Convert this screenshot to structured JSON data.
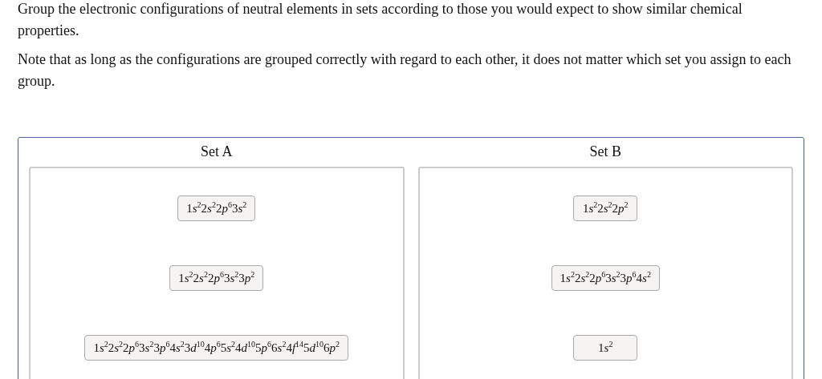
{
  "instructions": [
    "Group the electronic configurations of neutral elements in sets according to those you would expect to show similar chemical properties.",
    "Note that as long as the configurations are grouped correctly with regard to each other, it does not matter which set you assign to each group."
  ],
  "sets": [
    {
      "title": "Set A",
      "items": [
        [
          [
            "1",
            "s",
            "2"
          ],
          [
            "2",
            "s",
            "2"
          ],
          [
            "2",
            "p",
            "6"
          ],
          [
            "3",
            "s",
            "2"
          ]
        ],
        [
          [
            "1",
            "s",
            "2"
          ],
          [
            "2",
            "s",
            "2"
          ],
          [
            "2",
            "p",
            "6"
          ],
          [
            "3",
            "s",
            "2"
          ],
          [
            "3",
            "p",
            "2"
          ]
        ],
        [
          [
            "1",
            "s",
            "2"
          ],
          [
            "2",
            "s",
            "2"
          ],
          [
            "2",
            "p",
            "6"
          ],
          [
            "3",
            "s",
            "2"
          ],
          [
            "3",
            "p",
            "6"
          ],
          [
            "4",
            "s",
            "2"
          ],
          [
            "3",
            "d",
            "10"
          ],
          [
            "4",
            "p",
            "6"
          ],
          [
            "5",
            "s",
            "2"
          ],
          [
            "4",
            "d",
            "10"
          ],
          [
            "5",
            "p",
            "6"
          ],
          [
            "6",
            "s",
            "2"
          ],
          [
            "4",
            "f",
            "14"
          ],
          [
            "5",
            "d",
            "10"
          ],
          [
            "6",
            "p",
            "2"
          ]
        ]
      ]
    },
    {
      "title": "Set B",
      "items": [
        [
          [
            "1",
            "s",
            "2"
          ],
          [
            "2",
            "s",
            "2"
          ],
          [
            "2",
            "p",
            "2"
          ]
        ],
        [
          [
            "1",
            "s",
            "2"
          ],
          [
            "2",
            "s",
            "2"
          ],
          [
            "2",
            "p",
            "6"
          ],
          [
            "3",
            "s",
            "2"
          ],
          [
            "3",
            "p",
            "6"
          ],
          [
            "4",
            "s",
            "2"
          ]
        ],
        [
          [
            "1",
            "s",
            "2"
          ]
        ]
      ]
    }
  ]
}
